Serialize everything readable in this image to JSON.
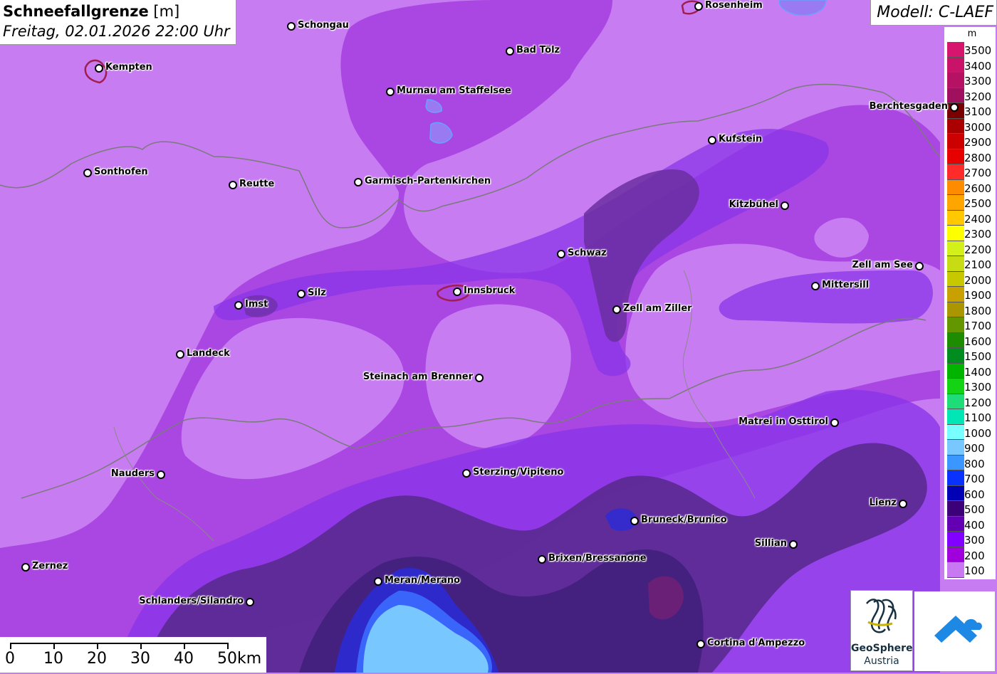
{
  "title": {
    "parameter": "Schneefallgrenze",
    "unit": "[m]",
    "datetime": "Freitag, 02.01.2026 22:00 Uhr"
  },
  "model": "Modell: C-LAEF",
  "legend": {
    "unit": "m",
    "entries": [
      {
        "value": "3500",
        "color": "#d6156e"
      },
      {
        "value": "3400",
        "color": "#c91368"
      },
      {
        "value": "3300",
        "color": "#b51263"
      },
      {
        "value": "3200",
        "color": "#a0105f"
      },
      {
        "value": "3100",
        "color": "#7a0000"
      },
      {
        "value": "3000",
        "color": "#aa0000"
      },
      {
        "value": "2900",
        "color": "#cc0000"
      },
      {
        "value": "2800",
        "color": "#e60000"
      },
      {
        "value": "2700",
        "color": "#ff2a2a"
      },
      {
        "value": "2600",
        "color": "#ff8c00"
      },
      {
        "value": "2500",
        "color": "#ffa500"
      },
      {
        "value": "2400",
        "color": "#ffc800"
      },
      {
        "value": "2300",
        "color": "#ffff00"
      },
      {
        "value": "2200",
        "color": "#d4f01a"
      },
      {
        "value": "2100",
        "color": "#c8dc14"
      },
      {
        "value": "2000",
        "color": "#c8c800"
      },
      {
        "value": "1900",
        "color": "#c8a000"
      },
      {
        "value": "1800",
        "color": "#aa9600"
      },
      {
        "value": "1700",
        "color": "#649600"
      },
      {
        "value": "1600",
        "color": "#1e8c00"
      },
      {
        "value": "1500",
        "color": "#008c1e"
      },
      {
        "value": "1400",
        "color": "#00b400"
      },
      {
        "value": "1300",
        "color": "#14d214"
      },
      {
        "value": "1200",
        "color": "#1edc78"
      },
      {
        "value": "1100",
        "color": "#00e6b4"
      },
      {
        "value": "1000",
        "color": "#78ffff"
      },
      {
        "value": "900",
        "color": "#78c8ff"
      },
      {
        "value": "800",
        "color": "#3c96ff"
      },
      {
        "value": "700",
        "color": "#0a32ff"
      },
      {
        "value": "600",
        "color": "#0000b4"
      },
      {
        "value": "500",
        "color": "#3c0078"
      },
      {
        "value": "400",
        "color": "#6400b4"
      },
      {
        "value": "300",
        "color": "#8200ff"
      },
      {
        "value": "200",
        "color": "#a000dc"
      },
      {
        "value": "100",
        "color": "#c878f0"
      }
    ]
  },
  "cities": [
    {
      "name": "Rosenheim",
      "label_side": "right"
    },
    {
      "name": "Schongau",
      "label_side": "right"
    },
    {
      "name": "Kempten",
      "label_side": "right"
    },
    {
      "name": "Bad Tölz",
      "label_side": "right"
    },
    {
      "name": "Murnau am Staffelsee",
      "label_side": "right"
    },
    {
      "name": "Berchtesgaden",
      "label_side": "left"
    },
    {
      "name": "Kufstein",
      "label_side": "right"
    },
    {
      "name": "Sonthofen",
      "label_side": "right"
    },
    {
      "name": "Reutte",
      "label_side": "right"
    },
    {
      "name": "Garmisch-Partenkirchen",
      "label_side": "right"
    },
    {
      "name": "Kitzbühel",
      "label_side": "left"
    },
    {
      "name": "Schwaz",
      "label_side": "right"
    },
    {
      "name": "Zell am See",
      "label_side": "left"
    },
    {
      "name": "Mittersill",
      "label_side": "right"
    },
    {
      "name": "Innsbruck",
      "label_side": "right"
    },
    {
      "name": "Silz",
      "label_side": "right"
    },
    {
      "name": "Imst",
      "label_side": "right"
    },
    {
      "name": "Zell am Ziller",
      "label_side": "right"
    },
    {
      "name": "Landeck",
      "label_side": "right"
    },
    {
      "name": "Steinach am Brenner",
      "label_side": "left"
    },
    {
      "name": "Matrei in Osttirol",
      "label_side": "left"
    },
    {
      "name": "Nauders",
      "label_side": "left"
    },
    {
      "name": "Sterzing/Vipiteno",
      "label_side": "right"
    },
    {
      "name": "Lienz",
      "label_side": "left"
    },
    {
      "name": "Bruneck/Brunico",
      "label_side": "right"
    },
    {
      "name": "Sillian",
      "label_side": "left"
    },
    {
      "name": "Brixen/Bressanone",
      "label_side": "right"
    },
    {
      "name": "Zernez",
      "label_side": "right"
    },
    {
      "name": "Meran/Merano",
      "label_side": "right"
    },
    {
      "name": "Schlanders/Silandro",
      "label_side": "left"
    },
    {
      "name": "Cortina d'Ampezzo",
      "label_side": "right"
    }
  ],
  "scale_bar": {
    "labels": [
      "0",
      "10",
      "20",
      "30",
      "40",
      "50km"
    ]
  },
  "logos": {
    "geosphere_name": "GeoSphere",
    "geosphere_sub": "Austria"
  }
}
